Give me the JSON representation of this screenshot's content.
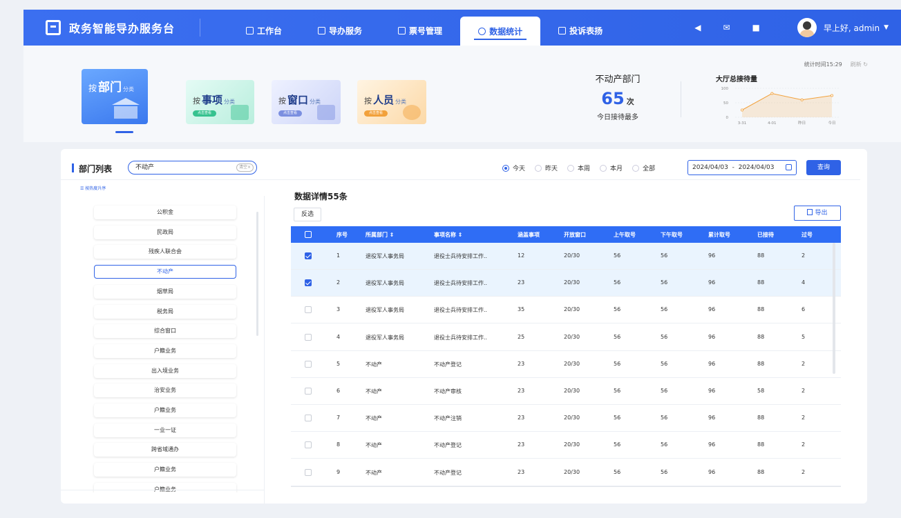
{
  "app": {
    "title": "政务智能导办服务台"
  },
  "nav": [
    {
      "label": "工作台",
      "icon": "cube-icon"
    },
    {
      "label": "导办服务",
      "icon": "server-icon"
    },
    {
      "label": "票号管理",
      "icon": "ticket-icon"
    },
    {
      "label": "数据统计",
      "icon": "clock-icon",
      "active": true
    },
    {
      "label": "投诉表扬",
      "icon": "clipboard-icon"
    }
  ],
  "user": {
    "greeting": "早上好, admin"
  },
  "categories": {
    "dept": {
      "prefix": "按",
      "name": "部门",
      "suffix": "分类"
    },
    "item": {
      "prefix": "按",
      "name": "事项",
      "suffix": "分类",
      "pill": "点击查看"
    },
    "window": {
      "prefix": "按",
      "name": "窗口",
      "suffix": "分类",
      "pill": "点击查看"
    },
    "staff": {
      "prefix": "按",
      "name": "人员",
      "suffix": "分类",
      "pill": "点击查看"
    }
  },
  "stat": {
    "title": "不动产部门",
    "count": "65",
    "unit": "次",
    "subtitle": "今日接待最多",
    "time_label": "统计时间15:29",
    "refresh": "刷新"
  },
  "mini_chart_title": "大厅总接待量",
  "chart_data": {
    "type": "area",
    "title": "大厅总接待量",
    "categories": [
      "3-31",
      "4-01",
      "昨日",
      "今日"
    ],
    "values": [
      25,
      82,
      60,
      75
    ],
    "ylim": [
      0,
      100
    ],
    "yticks": [
      0,
      50,
      100
    ],
    "color": "#f2a13b",
    "grid": true
  },
  "list": {
    "title": "部门列表",
    "search_value": "不动产",
    "clear_label": "清空×",
    "sort_label": "按热度升序",
    "items": [
      "公积金",
      "民政局",
      "残疾人联合会",
      "不动产",
      "烟草局",
      "税务局",
      "综合窗口",
      "户籍业务",
      "出入境业务",
      "治安业务",
      "户籍业务",
      "一业一证",
      "跨省域通办",
      "户籍业务",
      "户籍业务"
    ],
    "selected_index": 3
  },
  "filter": {
    "options": [
      "今天",
      "昨天",
      "本周",
      "本月",
      "全部"
    ],
    "selected": 0,
    "date_start": "2024/04/03",
    "date_sep": "-",
    "date_end": "2024/04/03",
    "query_label": "查询"
  },
  "detail": {
    "title": "数据详情55条",
    "invert_label": "反选",
    "export_label": "导出"
  },
  "table": {
    "headers": [
      "序号",
      "所属部门 ⇕",
      "事项名称 ⇕",
      "涵盖事项",
      "开放窗口",
      "上午取号",
      "下午取号",
      "累计取号",
      "已接待",
      "过号"
    ],
    "rows": [
      {
        "checked": true,
        "cells": [
          "1",
          "退役军人事务局",
          "退役士兵待安排工作..",
          "12",
          "20/30",
          "56",
          "56",
          "96",
          "88",
          "2"
        ]
      },
      {
        "checked": true,
        "cells": [
          "2",
          "退役军人事务局",
          "退役士兵待安排工作..",
          "23",
          "20/30",
          "56",
          "56",
          "96",
          "88",
          "4"
        ]
      },
      {
        "checked": false,
        "cells": [
          "3",
          "退役军人事务局",
          "退役士兵待安排工作..",
          "35",
          "20/30",
          "56",
          "56",
          "96",
          "88",
          "6"
        ]
      },
      {
        "checked": false,
        "cells": [
          "4",
          "退役军人事务局",
          "退役士兵待安排工作..",
          "25",
          "20/30",
          "56",
          "56",
          "96",
          "88",
          "5"
        ]
      },
      {
        "checked": false,
        "cells": [
          "5",
          "不动产",
          "不动产登记",
          "23",
          "20/30",
          "56",
          "56",
          "96",
          "88",
          "2"
        ]
      },
      {
        "checked": false,
        "cells": [
          "6",
          "不动产",
          "不动产审核",
          "23",
          "20/30",
          "56",
          "56",
          "96",
          "58",
          "2"
        ]
      },
      {
        "checked": false,
        "cells": [
          "7",
          "不动产",
          "不动产注销",
          "23",
          "20/30",
          "56",
          "56",
          "96",
          "88",
          "2"
        ]
      },
      {
        "checked": false,
        "cells": [
          "8",
          "不动产",
          "不动产登记",
          "23",
          "20/30",
          "56",
          "56",
          "96",
          "88",
          "2"
        ]
      },
      {
        "checked": false,
        "cells": [
          "9",
          "不动产",
          "不动产登记",
          "23",
          "20/30",
          "56",
          "56",
          "96",
          "88",
          "2"
        ]
      }
    ]
  }
}
